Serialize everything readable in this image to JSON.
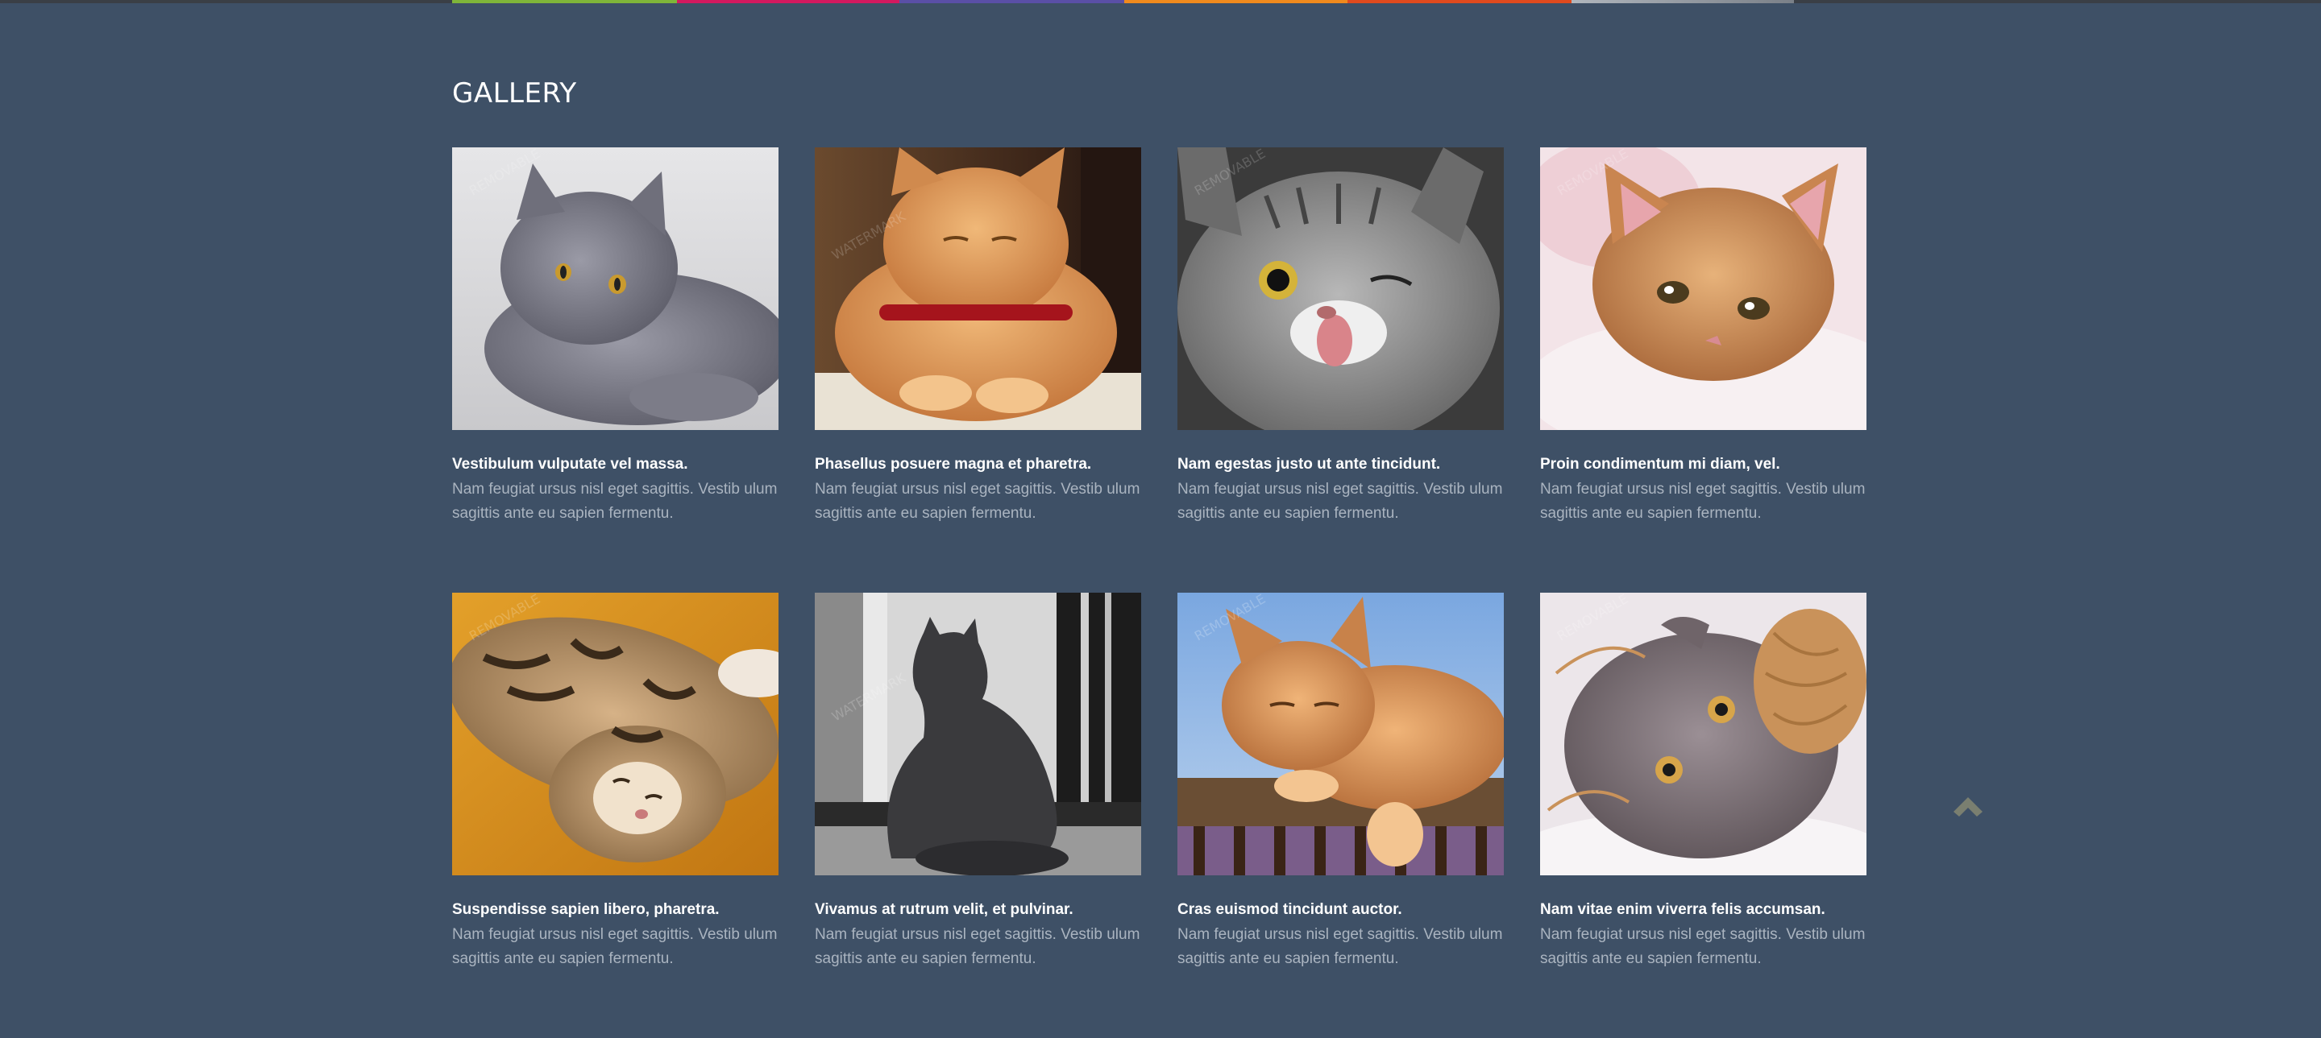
{
  "colors": {
    "background": "#3e5066",
    "stripe": [
      "#3a3f46",
      "#7fb539",
      "#d3195f",
      "#5a4fa6",
      "#f08a1d",
      "#e04a1e",
      "#b0b6bd",
      "#3a3f46"
    ]
  },
  "gallery": {
    "title": "GALLERY",
    "items": [
      {
        "title": "Vestibulum vulputate vel massa.",
        "description": "Nam feugiat ursus nisl eget sagittis. Vestib ulum sagittis ante eu sapien fermentu.",
        "image": "grey-cat-lying-photo",
        "watermark": "REMOVABLE WATERMARK"
      },
      {
        "title": "Phasellus posuere magna et pharetra.",
        "description": "Nam feugiat ursus nisl eget sagittis. Vestib ulum sagittis ante eu sapien fermentu.",
        "image": "ginger-cat-red-collar-photo",
        "watermark": "REMOVABLE WATERMARK"
      },
      {
        "title": "Nam egestas justo ut ante tincidunt.",
        "description": "Nam feugiat ursus nisl eget sagittis. Vestib ulum sagittis ante eu sapien fermentu.",
        "image": "tabby-cat-winking-photo",
        "watermark": "REMOVABLE WATERMARK"
      },
      {
        "title": "Proin condimentum mi diam, vel.",
        "description": "Nam feugiat ursus nisl eget sagittis. Vestib ulum sagittis ante eu sapien fermentu.",
        "image": "orange-kitten-blanket-photo",
        "watermark": "REMOVABLE WATERMARK"
      },
      {
        "title": "Suspendisse sapien libero, pharetra.",
        "description": "Nam feugiat ursus nisl eget sagittis. Vestib ulum sagittis ante eu sapien fermentu.",
        "image": "tabby-cat-sleeping-photo",
        "watermark": "REMOVABLE WATERMARK"
      },
      {
        "title": "Vivamus at rutrum velit, et pulvinar.",
        "description": "Nam feugiat ursus nisl eget sagittis. Vestib ulum sagittis ante eu sapien fermentu.",
        "image": "black-cat-window-photo",
        "watermark": "REMOVABLE WATERMARK"
      },
      {
        "title": "Cras euismod tincidunt auctor.",
        "description": "Nam feugiat ursus nisl eget sagittis. Vestib ulum sagittis ante eu sapien fermentu.",
        "image": "ginger-cat-fence-photo",
        "watermark": "REMOVABLE WATERMARK"
      },
      {
        "title": "Nam vitae enim viverra felis accumsan.",
        "description": "Nam feugiat ursus nisl eget sagittis. Vestib ulum sagittis ante eu sapien fermentu.",
        "image": "grey-cat-yarn-photo",
        "watermark": "REMOVABLE WATERMARK"
      }
    ]
  },
  "scroll_top": {
    "icon": "chevron-up-icon"
  }
}
